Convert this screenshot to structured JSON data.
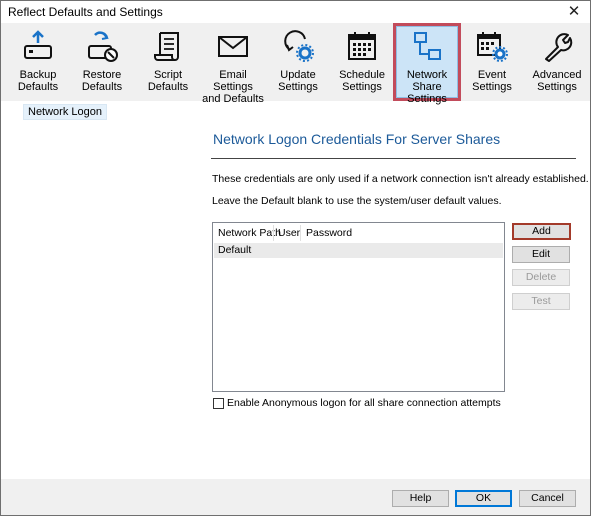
{
  "window": {
    "title": "Reflect Defaults and Settings",
    "close_glyph": "✕"
  },
  "toolbar": {
    "items": [
      {
        "label1": "Backup",
        "label2": "Defaults",
        "icon": "backup-disk-icon"
      },
      {
        "label1": "Restore",
        "label2": "Defaults",
        "icon": "restore-disk-icon"
      },
      {
        "label1": "Script",
        "label2": "Defaults",
        "icon": "script-scroll-icon"
      },
      {
        "label1": "Email Settings",
        "label2": "and Defaults",
        "icon": "envelope-icon"
      },
      {
        "label1": "Update",
        "label2": "Settings",
        "icon": "update-gear-icon"
      },
      {
        "label1": "Schedule",
        "label2": "Settings",
        "icon": "calendar-icon"
      },
      {
        "label1": "Network Share",
        "label2": "Settings",
        "icon": "network-share-icon",
        "active": true
      },
      {
        "label1": "Event",
        "label2": "Settings",
        "icon": "calendar-gear-icon"
      },
      {
        "label1": "Advanced",
        "label2": "Settings",
        "icon": "wrench-icon"
      }
    ]
  },
  "sidebar": {
    "selected": "Network Logon"
  },
  "content": {
    "heading": "Network Logon Credentials For Server Shares",
    "info1": "These credentials are only used if a network connection isn't already established.",
    "info2": "Leave the Default blank to use the system/user default values.",
    "table": {
      "columns": [
        "Network Path",
        "User",
        "Password"
      ],
      "rows": [
        {
          "path": "Default",
          "user": "",
          "password": ""
        }
      ]
    },
    "buttons": {
      "add": "Add",
      "edit": "Edit",
      "delete": "Delete",
      "test": "Test"
    },
    "anon_checkbox": {
      "label": "Enable Anonymous logon for all share connection attempts",
      "checked": false
    }
  },
  "footer": {
    "help": "Help",
    "ok": "OK",
    "cancel": "Cancel"
  },
  "colors": {
    "accent": "#1c5a99",
    "highlight": "#c24b5b",
    "selected_bg": "#cce4f7"
  }
}
